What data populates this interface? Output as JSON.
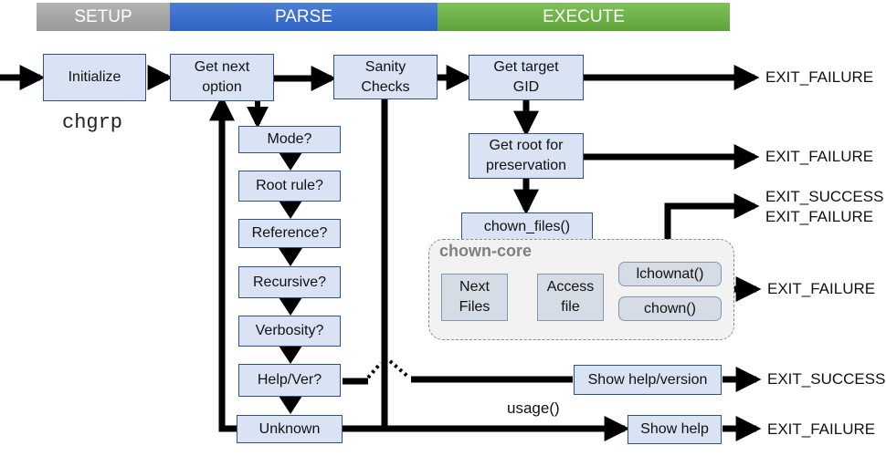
{
  "phases": {
    "setup": "SETUP",
    "parse": "PARSE",
    "execute": "EXECUTE"
  },
  "phase_colors": {
    "setup": "#a6a6a6",
    "parse": "#3a6fcf",
    "execute": "#6cb245"
  },
  "boxes": {
    "initialize": "Initialize",
    "get_next_option": "Get next option",
    "sanity_checks": "Sanity Checks",
    "get_target_gid": "Get target GID",
    "get_root": "Get root for preservation",
    "chown_files": "chown_files()",
    "mode": "Mode?",
    "root_rule": "Root rule?",
    "reference": "Reference?",
    "recursive": "Recursive?",
    "verbosity": "Verbosity?",
    "help_ver": "Help/Ver?",
    "unknown": "Unknown",
    "show_help_version": "Show help/version",
    "show_help": "Show help"
  },
  "program_name": "chgrp",
  "core": {
    "title": "chown-core",
    "next_files": "Next Files",
    "access_file": "Access file",
    "lchownat": "lchownat()",
    "chown": "chown()"
  },
  "exits": {
    "gid_failure": "EXIT_FAILURE",
    "root_failure": "EXIT_FAILURE",
    "files_success": "EXIT_SUCCESS",
    "files_failure": "EXIT_FAILURE",
    "core_failure": "EXIT_FAILURE",
    "help_success": "EXIT_SUCCESS",
    "usage_failure": "EXIT_FAILURE"
  },
  "usage_label": "usage()"
}
